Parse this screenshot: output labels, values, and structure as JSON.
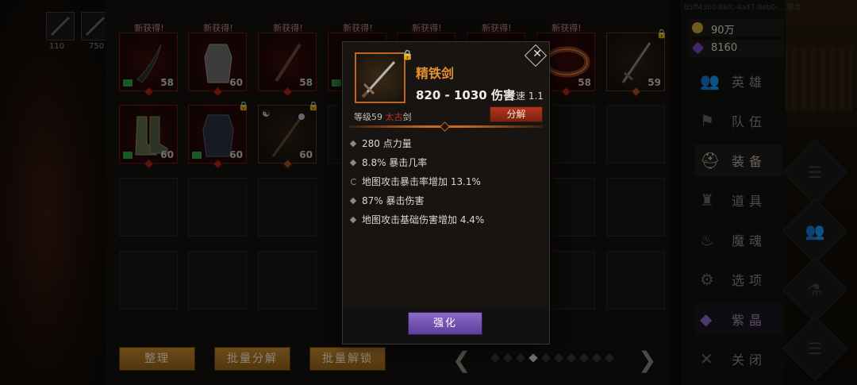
{
  "top_left": {
    "counts": [
      "110",
      "750"
    ]
  },
  "top_id_text": "05ff43b0-86fc-4a47-8eb0-... 联合",
  "inventory": {
    "new_label": "新获得!",
    "row1": [
      {
        "level": "58",
        "new": true,
        "book": true,
        "type": "crescent-blade"
      },
      {
        "level": "60",
        "new": true,
        "book": false,
        "type": "armor-coat"
      },
      {
        "level": "58",
        "new": true,
        "book": false,
        "type": "sword"
      },
      {
        "level": "",
        "new": true,
        "book": true,
        "type": "hidden"
      },
      {
        "level": "",
        "new": true,
        "book": false,
        "type": "hidden"
      },
      {
        "level": "",
        "new": true,
        "book": false,
        "type": "hidden"
      },
      {
        "level": "58",
        "new": true,
        "book": false,
        "type": "belt"
      },
      {
        "level": "59",
        "new": false,
        "book": false,
        "type": "sword",
        "lock": true
      }
    ],
    "row2": [
      {
        "level": "60",
        "new": false,
        "book": true,
        "type": "boots"
      },
      {
        "level": "60",
        "new": false,
        "book": true,
        "type": "armor-coat",
        "lock": true
      },
      {
        "level": "60",
        "new": false,
        "book": false,
        "type": "staff",
        "lock": true,
        "yinyang": true
      }
    ]
  },
  "bottom_buttons": {
    "sort": "整理",
    "batch_dismantle": "批量分解",
    "batch_unlock": "批量解锁"
  },
  "pager": {
    "total_pages": 10,
    "active_page": 4
  },
  "sidebar": {
    "gold": "90万",
    "crystals": "8160",
    "menu": [
      {
        "label": "英雄",
        "icon": "hero-icon"
      },
      {
        "label": "队伍",
        "icon": "flag-icon"
      },
      {
        "label": "装备",
        "icon": "helmet-icon",
        "active": true
      },
      {
        "label": "道具",
        "icon": "bag-icon"
      },
      {
        "label": "魔魂",
        "icon": "flame-icon"
      },
      {
        "label": "选项",
        "icon": "gear-icon"
      },
      {
        "label": "紫晶",
        "icon": "crystal-icon",
        "purple": true
      },
      {
        "label": "关闭",
        "icon": "close-x-icon"
      }
    ]
  },
  "popup": {
    "item_name": "精铁剑",
    "damage": "820 - 1030 伤害",
    "attack_speed_label": "攻速 1.1",
    "level_prefix": "等级59",
    "quality": "太古",
    "category": "剑",
    "dismantle_label": "分解",
    "stats": [
      {
        "text": "280 点力量",
        "marker": "diamond"
      },
      {
        "text": "8.8% 暴击几率",
        "marker": "diamond"
      },
      {
        "text": "地图攻击暴击率增加 13.1%",
        "marker": "ring"
      },
      {
        "text": "87% 暴击伤害",
        "marker": "diamond"
      },
      {
        "text": "地图攻击基础伤害增加 4.4%",
        "marker": "diamond"
      }
    ],
    "upgrade_label": "强化"
  },
  "colors": {
    "item_name": "#e6902f",
    "quality_red": "#c3302a",
    "upgrade_purple": "#7352b0",
    "bottom_button_gold": "#b87a24"
  }
}
